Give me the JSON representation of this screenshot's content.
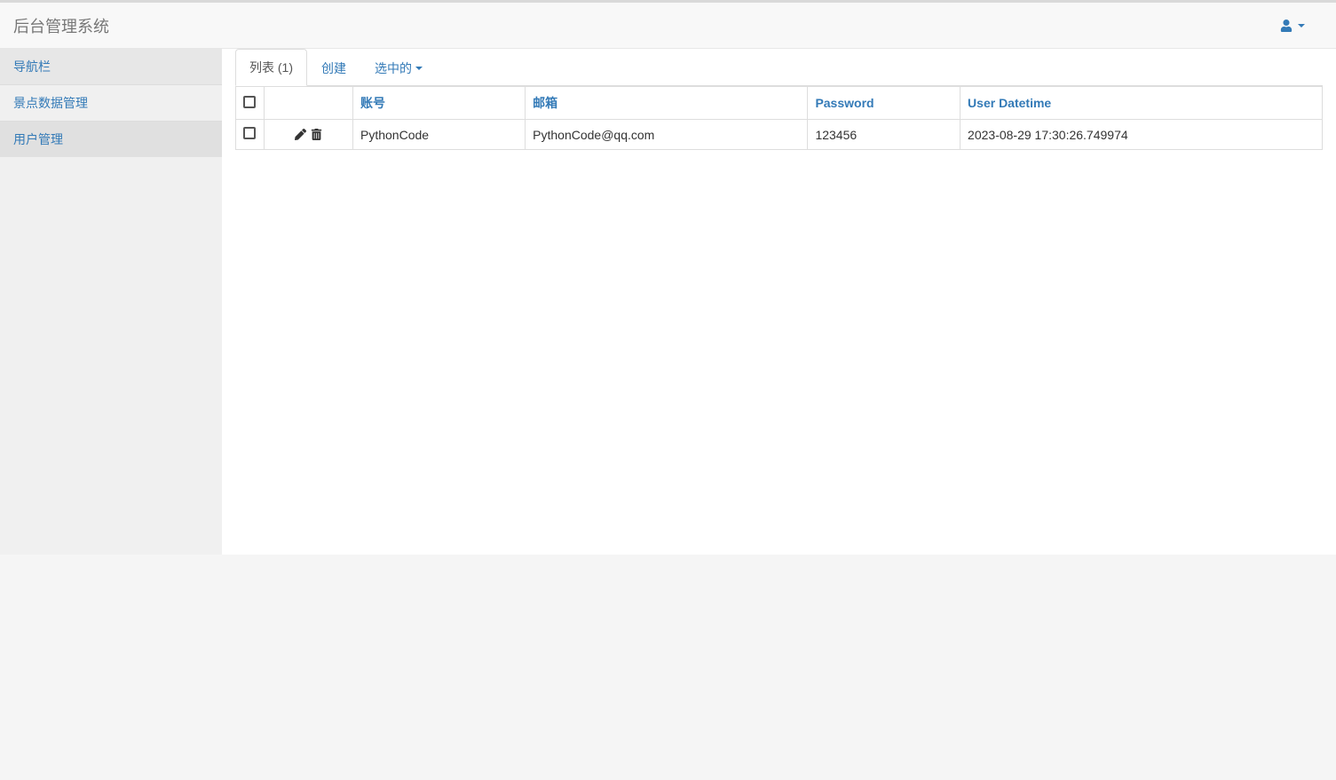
{
  "navbar": {
    "brand": "后台管理系统"
  },
  "sidebar": {
    "header": "导航栏",
    "items": [
      {
        "label": "景点数据管理"
      },
      {
        "label": "用户管理"
      }
    ]
  },
  "tabs": {
    "list": "列表 (1)",
    "create": "创建",
    "selected": "选中的"
  },
  "table": {
    "headers": {
      "account": "账号",
      "email": "邮箱",
      "password": "Password",
      "datetime": "User Datetime"
    },
    "rows": [
      {
        "account": "PythonCode",
        "email": "PythonCode@qq.com",
        "password": "123456",
        "datetime": "2023-08-29 17:30:26.749974"
      }
    ]
  }
}
